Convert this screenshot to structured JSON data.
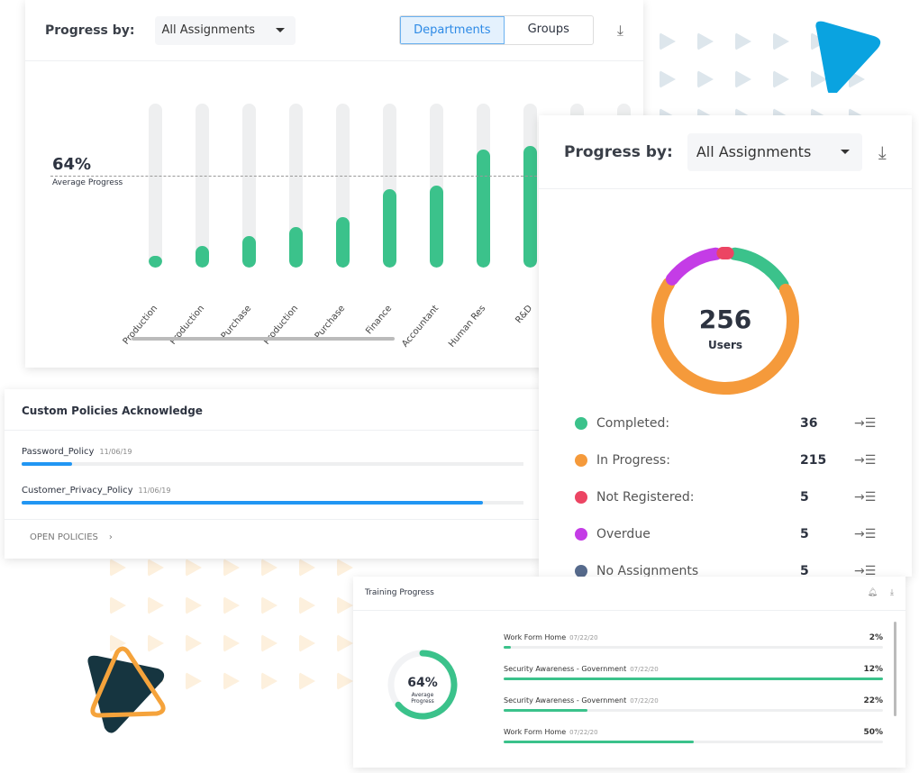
{
  "colors": {
    "green": "#3bc28b",
    "orange": "#f59a3b",
    "red": "#ec4563",
    "purple": "#c43ce6",
    "slate": "#566a8c",
    "blue": "#2196f3",
    "brand_blue": "#0aa3e0"
  },
  "dept_card": {
    "progress_label": "Progress by:",
    "select_value": "All Assignments",
    "tabs": [
      {
        "label": "Departments",
        "active": true
      },
      {
        "label": "Groups",
        "active": false
      }
    ],
    "download_icon": "download-icon",
    "avg_value": "64%",
    "avg_label": "Average Progress"
  },
  "chart_data": {
    "type": "bar",
    "categories": [
      "Production",
      "Production",
      "Purchase",
      "Production",
      "Purchase",
      "Finance",
      "Accountant",
      "Human Res",
      "R&D"
    ],
    "values": [
      7,
      13,
      19,
      25,
      31,
      48,
      50,
      72,
      74
    ],
    "ylim": [
      0,
      100
    ],
    "average": 64,
    "grid": false
  },
  "policies": {
    "title": "Custom Policies Acknowledge",
    "items": [
      {
        "name": "Password_Policy",
        "date": "11/06/19",
        "progress": 10
      },
      {
        "name": "Customer_Privacy_Policy",
        "date": "11/06/19",
        "progress": 92
      }
    ],
    "open_label": "OPEN POLICIES"
  },
  "users_card": {
    "progress_label": "Progress by:",
    "select_value": "All Assignments",
    "total": "256",
    "total_label": "Users",
    "legend": [
      {
        "label": "Completed:",
        "value": "36",
        "color": "#3bc28b"
      },
      {
        "label": "In Progress:",
        "value": "215",
        "color": "#f59a3b"
      },
      {
        "label": "Not Registered:",
        "value": "5",
        "color": "#ec4563"
      },
      {
        "label": "Overdue",
        "value": "5",
        "color": "#c43ce6"
      },
      {
        "label": "No Assignments",
        "value": "5",
        "color": "#566a8c"
      }
    ]
  },
  "training": {
    "title": "Training Progress",
    "avg_value": "64%",
    "avg_label": "Average Progress",
    "avg": 64,
    "items": [
      {
        "name": "Work Form Home",
        "date": "07/22/20",
        "pct": "2%",
        "value": 2
      },
      {
        "name": "Security Awareness - Government",
        "date": "07/22/20",
        "pct": "12%",
        "value": 100
      },
      {
        "name": "Security Awareness - Government",
        "date": "07/22/20",
        "pct": "22%",
        "value": 22
      },
      {
        "name": "Work Form Home",
        "date": "07/22/20",
        "pct": "50%",
        "value": 50
      }
    ]
  }
}
